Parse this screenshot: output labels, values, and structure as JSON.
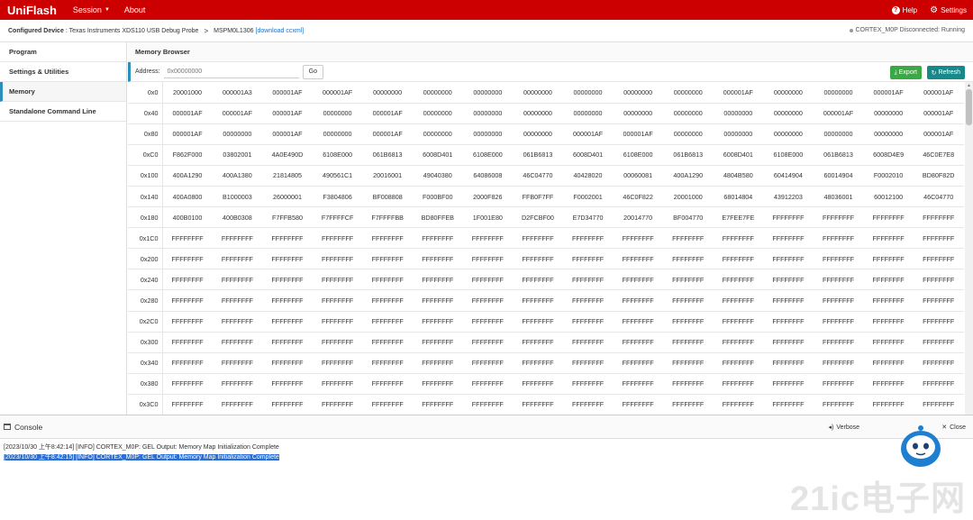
{
  "app": {
    "brand": "UniFlash",
    "menu": {
      "session": "Session",
      "about": "About"
    },
    "help": "Help",
    "settings": "Settings"
  },
  "device_bar": {
    "configured_label": "Configured Device",
    "configured_value": ": Texas Instruments XDS110 USB Debug Probe",
    "chevron": ">",
    "device": "MSPM0L1306",
    "download_link": "[download ccxml]",
    "status": "CORTEX_M0P Disconnected: Running"
  },
  "sidebar": {
    "items": [
      {
        "label": "Program"
      },
      {
        "label": "Settings & Utilities"
      },
      {
        "label": "Memory"
      },
      {
        "label": "Standalone Command Line"
      }
    ]
  },
  "memory_browser": {
    "title": "Memory Browser",
    "address_label": "Address:",
    "address_placeholder": "0x00000000",
    "go_label": "Go",
    "export_label": "Export",
    "refresh_label": "Refresh",
    "rows": [
      {
        "addr": "0x0",
        "values": [
          "20001000",
          "000001A3",
          "000001AF",
          "000001AF",
          "00000000",
          "00000000",
          "00000000",
          "00000000",
          "00000000",
          "00000000",
          "00000000",
          "000001AF",
          "00000000",
          "00000000",
          "000001AF",
          "000001AF"
        ]
      },
      {
        "addr": "0x40",
        "values": [
          "000001AF",
          "000001AF",
          "000001AF",
          "00000000",
          "000001AF",
          "00000000",
          "00000000",
          "00000000",
          "00000000",
          "00000000",
          "00000000",
          "00000000",
          "00000000",
          "000001AF",
          "00000000",
          "000001AF"
        ]
      },
      {
        "addr": "0x80",
        "values": [
          "000001AF",
          "00000000",
          "000001AF",
          "00000000",
          "000001AF",
          "00000000",
          "00000000",
          "00000000",
          "000001AF",
          "000001AF",
          "00000000",
          "00000000",
          "00000000",
          "00000000",
          "00000000",
          "000001AF"
        ]
      },
      {
        "addr": "0xC0",
        "values": [
          "F862F000",
          "03802001",
          "4A0E490D",
          "6108E000",
          "061B6813",
          "6008D401",
          "6108E000",
          "061B6813",
          "6008D401",
          "6108E000",
          "061B6813",
          "6008D401",
          "6108E000",
          "061B6813",
          "6008D4E9",
          "46C0E7E8"
        ]
      },
      {
        "addr": "0x100",
        "values": [
          "400A1290",
          "400A1380",
          "21814805",
          "490561C1",
          "20016001",
          "49040380",
          "64086008",
          "46C04770",
          "40428020",
          "00060081",
          "400A1290",
          "4804B580",
          "60414904",
          "60014904",
          "F0002010",
          "BD80F82D"
        ]
      },
      {
        "addr": "0x140",
        "values": [
          "400A0800",
          "B1000003",
          "26000001",
          "F3804806",
          "BF008808",
          "F000BF00",
          "2000F826",
          "FFB0F7FF",
          "F0002001",
          "46C0F822",
          "20001000",
          "68014804",
          "43912203",
          "48036001",
          "60012100",
          "46C04770"
        ]
      },
      {
        "addr": "0x180",
        "values": [
          "400B0100",
          "400B0308",
          "F7FFB580",
          "F7FFFFCF",
          "F7FFFFBB",
          "BD80FFEB",
          "1F001E80",
          "D2FCBF00",
          "E7D34770",
          "20014770",
          "BF004770",
          "E7FEE7FE",
          "FFFFFFFF",
          "FFFFFFFF",
          "FFFFFFFF",
          "FFFFFFFF"
        ]
      },
      {
        "addr": "0x1C0",
        "values": [
          "FFFFFFFF",
          "FFFFFFFF",
          "FFFFFFFF",
          "FFFFFFFF",
          "FFFFFFFF",
          "FFFFFFFF",
          "FFFFFFFF",
          "FFFFFFFF",
          "FFFFFFFF",
          "FFFFFFFF",
          "FFFFFFFF",
          "FFFFFFFF",
          "FFFFFFFF",
          "FFFFFFFF",
          "FFFFFFFF",
          "FFFFFFFF"
        ]
      },
      {
        "addr": "0x200",
        "values": [
          "FFFFFFFF",
          "FFFFFFFF",
          "FFFFFFFF",
          "FFFFFFFF",
          "FFFFFFFF",
          "FFFFFFFF",
          "FFFFFFFF",
          "FFFFFFFF",
          "FFFFFFFF",
          "FFFFFFFF",
          "FFFFFFFF",
          "FFFFFFFF",
          "FFFFFFFF",
          "FFFFFFFF",
          "FFFFFFFF",
          "FFFFFFFF"
        ]
      },
      {
        "addr": "0x240",
        "values": [
          "FFFFFFFF",
          "FFFFFFFF",
          "FFFFFFFF",
          "FFFFFFFF",
          "FFFFFFFF",
          "FFFFFFFF",
          "FFFFFFFF",
          "FFFFFFFF",
          "FFFFFFFF",
          "FFFFFFFF",
          "FFFFFFFF",
          "FFFFFFFF",
          "FFFFFFFF",
          "FFFFFFFF",
          "FFFFFFFF",
          "FFFFFFFF"
        ]
      },
      {
        "addr": "0x280",
        "values": [
          "FFFFFFFF",
          "FFFFFFFF",
          "FFFFFFFF",
          "FFFFFFFF",
          "FFFFFFFF",
          "FFFFFFFF",
          "FFFFFFFF",
          "FFFFFFFF",
          "FFFFFFFF",
          "FFFFFFFF",
          "FFFFFFFF",
          "FFFFFFFF",
          "FFFFFFFF",
          "FFFFFFFF",
          "FFFFFFFF",
          "FFFFFFFF"
        ]
      },
      {
        "addr": "0x2C0",
        "values": [
          "FFFFFFFF",
          "FFFFFFFF",
          "FFFFFFFF",
          "FFFFFFFF",
          "FFFFFFFF",
          "FFFFFFFF",
          "FFFFFFFF",
          "FFFFFFFF",
          "FFFFFFFF",
          "FFFFFFFF",
          "FFFFFFFF",
          "FFFFFFFF",
          "FFFFFFFF",
          "FFFFFFFF",
          "FFFFFFFF",
          "FFFFFFFF"
        ]
      },
      {
        "addr": "0x300",
        "values": [
          "FFFFFFFF",
          "FFFFFFFF",
          "FFFFFFFF",
          "FFFFFFFF",
          "FFFFFFFF",
          "FFFFFFFF",
          "FFFFFFFF",
          "FFFFFFFF",
          "FFFFFFFF",
          "FFFFFFFF",
          "FFFFFFFF",
          "FFFFFFFF",
          "FFFFFFFF",
          "FFFFFFFF",
          "FFFFFFFF",
          "FFFFFFFF"
        ]
      },
      {
        "addr": "0x340",
        "values": [
          "FFFFFFFF",
          "FFFFFFFF",
          "FFFFFFFF",
          "FFFFFFFF",
          "FFFFFFFF",
          "FFFFFFFF",
          "FFFFFFFF",
          "FFFFFFFF",
          "FFFFFFFF",
          "FFFFFFFF",
          "FFFFFFFF",
          "FFFFFFFF",
          "FFFFFFFF",
          "FFFFFFFF",
          "FFFFFFFF",
          "FFFFFFFF"
        ]
      },
      {
        "addr": "0x380",
        "values": [
          "FFFFFFFF",
          "FFFFFFFF",
          "FFFFFFFF",
          "FFFFFFFF",
          "FFFFFFFF",
          "FFFFFFFF",
          "FFFFFFFF",
          "FFFFFFFF",
          "FFFFFFFF",
          "FFFFFFFF",
          "FFFFFFFF",
          "FFFFFFFF",
          "FFFFFFFF",
          "FFFFFFFF",
          "FFFFFFFF",
          "FFFFFFFF"
        ]
      },
      {
        "addr": "0x3C0",
        "values": [
          "FFFFFFFF",
          "FFFFFFFF",
          "FFFFFFFF",
          "FFFFFFFF",
          "FFFFFFFF",
          "FFFFFFFF",
          "FFFFFFFF",
          "FFFFFFFF",
          "FFFFFFFF",
          "FFFFFFFF",
          "FFFFFFFF",
          "FFFFFFFF",
          "FFFFFFFF",
          "FFFFFFFF",
          "FFFFFFFF",
          "FFFFFFFF"
        ]
      }
    ]
  },
  "console": {
    "title": "Console",
    "verbose_label": "Verbose",
    "close_label": "Close",
    "lines": [
      "[2023/10/30 上午8:42:14] [INFO] CORTEX_M0P: GEL Output: Memory Map Initialization Complete",
      "[2023/10/30 上午8:42:15] [INFO] CORTEX_M0P: GEL Output: Memory Map Initialization Complete"
    ]
  },
  "watermark": "21ic电子网",
  "colors": {
    "header": "#cc0000",
    "accent": "#2a8fbd",
    "export": "#3aa845",
    "refresh": "#168a8a",
    "selection": "#2a6fd6"
  }
}
